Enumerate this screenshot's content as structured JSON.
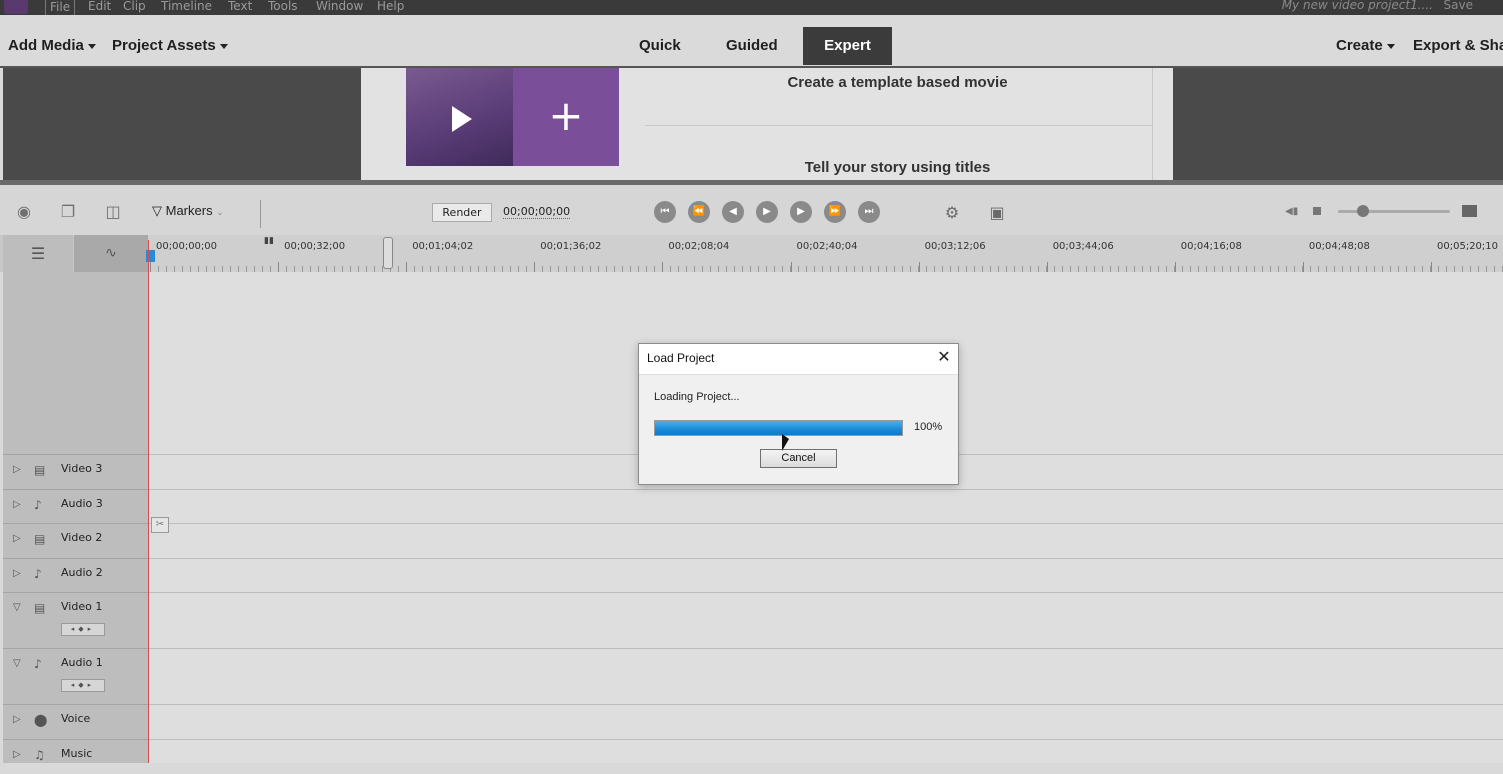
{
  "menu": {
    "file": "File",
    "edit": "Edit",
    "clip": "Clip",
    "timeline": "Timeline",
    "text": "Text",
    "tools": "Tools",
    "window": "Window",
    "help": "Help"
  },
  "window": {
    "project_title": "My new video project1....",
    "save": "Save"
  },
  "toolbar": {
    "add_media": "Add Media",
    "project_assets": "Project Assets",
    "create": "Create",
    "export_share": "Export & Sha"
  },
  "modes": {
    "quick": "Quick",
    "guided": "Guided",
    "expert": "Expert"
  },
  "guided": {
    "template_movie": "Create a template based movie",
    "story_titles": "Tell your story using titles",
    "plus": "+"
  },
  "timeline_toolbar": {
    "markers": "Markers",
    "render": "Render",
    "timecode": "00;00;00;00"
  },
  "ruler": {
    "labels": [
      "00;00;00;00",
      "00;00;32;00",
      "00;01;04;02",
      "00;01;36;02",
      "00;02;08;04",
      "00;02;40;04",
      "00;03;12;06",
      "00;03;44;06",
      "00;04;16;08",
      "00;04;48;08",
      "00;05;20;10"
    ]
  },
  "tracks": [
    {
      "name": "Video 3",
      "icon": "film-icon",
      "expanded": false
    },
    {
      "name": "Audio 3",
      "icon": "speaker-icon",
      "expanded": false
    },
    {
      "name": "Video 2",
      "icon": "film-icon",
      "expanded": false
    },
    {
      "name": "Audio 2",
      "icon": "speaker-icon",
      "expanded": false
    },
    {
      "name": "Video 1",
      "icon": "film-icon",
      "expanded": true
    },
    {
      "name": "Audio 1",
      "icon": "speaker-icon",
      "expanded": true
    },
    {
      "name": "Voice",
      "icon": "microphone-icon",
      "expanded": false
    },
    {
      "name": "Music",
      "icon": "music-note-icon",
      "expanded": false
    }
  ],
  "dialog": {
    "title": "Load Project",
    "message": "Loading Project...",
    "progress_percent": 100,
    "progress_label": "100%",
    "cancel": "Cancel"
  },
  "colors": {
    "accent_expert": "#3b3b3b",
    "progress": "#1a8ad8",
    "playhead": "#d05050",
    "guided_purple": "#7b4e9a"
  }
}
